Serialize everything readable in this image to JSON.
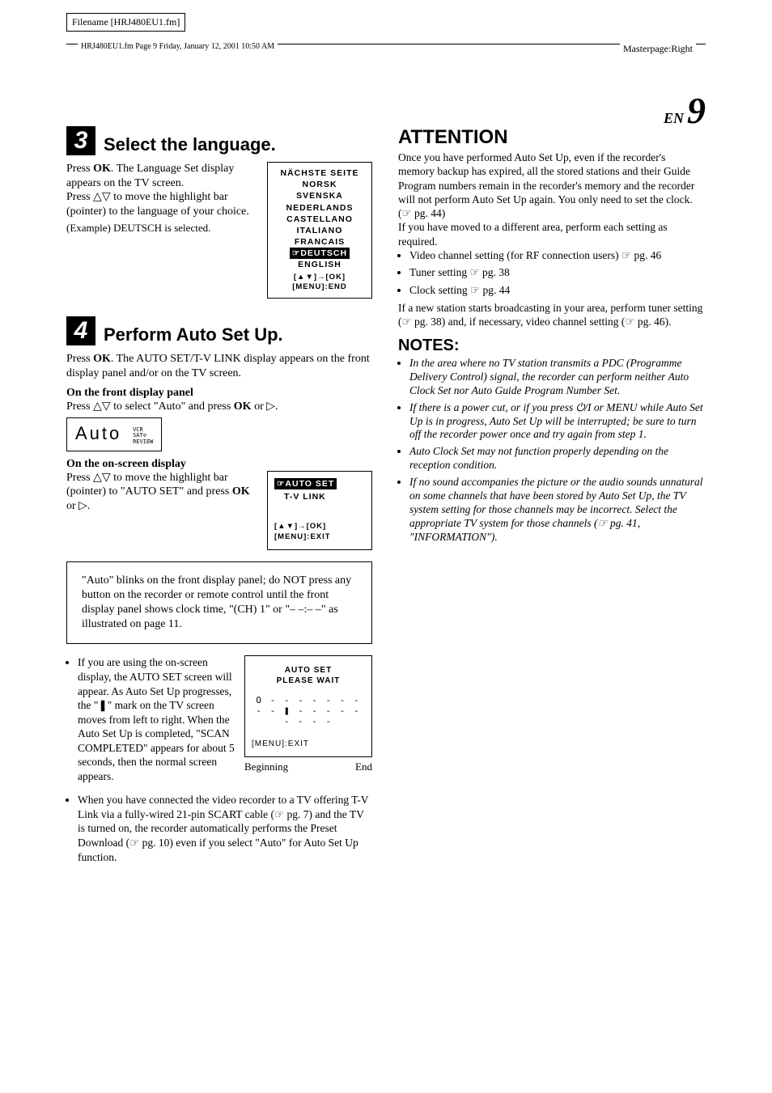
{
  "meta": {
    "filename_label": "Filename [HRJ480EU1.fm]",
    "header_text": "HRJ480EU1.fm  Page 9  Friday, January 12, 2001  10:50 AM",
    "masterpage": "Masterpage:Right",
    "page_lang": "EN",
    "page_num": "9"
  },
  "step3": {
    "num": "3",
    "title": "Select the language.",
    "p1a": "Press ",
    "p1ok": "OK",
    "p1b": ". The Language Set display appears on the TV screen.",
    "p2a": "Press △▽ to move the highlight bar (pointer) to the language of your choice.",
    "p3": "(Example) DEUTSCH is selected.",
    "panel": {
      "l1": "NÄCHSTE SEITE",
      "l2": "NORSK",
      "l3": "SVENSKA",
      "l4": "NEDERLANDS",
      "l5": "CASTELLANO",
      "l6": "ITALIANO",
      "l7": "FRANCAIS",
      "sel": "☞DEUTSCH",
      "l8": "ENGLISH",
      "bot": "[▲▼]→[OK]\n[MENU]:END"
    }
  },
  "step4": {
    "num": "4",
    "title": "Perform Auto Set Up.",
    "p1a": "Press ",
    "p1ok": "OK",
    "p1b": ". The AUTO SET/T-V LINK display appears on the front display panel and/or on the TV screen.",
    "sub1": "On the front display panel",
    "sel_auto": "Press △▽ to select \"Auto\" and press ",
    "ok": "OK",
    "or_tri": " or ▷.",
    "seg_text": "Auto",
    "seg_side": "VCR\nSAT⊙\nREVIEW",
    "sub2": "On the on-screen display",
    "p3": "Press △▽ to move the highlight bar (pointer) to \"AUTO SET\" and press ",
    "p3b": " or ▷.",
    "panel2": {
      "sel": "☞AUTO SET",
      "l2": "T-V LINK",
      "bot": "[▲▼]→[OK]\n[MENU]:EXIT"
    },
    "blockquote": "\"Auto\" blinks on the front display panel; do NOT press any button on the recorder or remote control until the front display panel shows clock time, \"(CH) 1\" or \"– –:– –\" as illustrated on page 11.",
    "bul1": "If you are using the on-screen display, the AUTO SET screen will appear. As Auto Set Up progresses, the \"❚\" mark on the TV screen moves from left to right. When the Auto Set Up is completed, \"SCAN COMPLETED\" appears for about 5 seconds, then the normal screen appears.",
    "progress": {
      "t1": "AUTO SET",
      "t2": "PLEASE WAIT",
      "row": "O - - - - -    - - - - ❚ - - - -    - - - - -",
      "menu": "[MENU]:EXIT",
      "beg": "Beginning",
      "end": "End"
    },
    "bul2": "When you have connected the video recorder to a TV offering T-V Link via a fully-wired 21-pin SCART cable (☞ pg. 7) and the TV is turned on, the recorder automatically performs the Preset Download (☞ pg. 10) even if you select \"Auto\" for Auto Set Up function."
  },
  "right": {
    "att_title": "ATTENTION",
    "att_p1": "Once you have performed Auto Set Up, even if the recorder's memory backup has expired, all the stored stations and their Guide Program numbers remain in the recorder's memory and the recorder will not perform Auto Set Up again. You only need to set the clock. (☞ pg. 44)",
    "att_p2": "If you have moved to a different area, perform each setting as required.",
    "att_li1": "Video channel setting (for RF connection users) ☞ pg. 46",
    "att_li2": "Tuner setting ☞ pg. 38",
    "att_li3": "Clock setting ☞ pg. 44",
    "att_p3": "If a new station starts broadcasting in your area, perform tuner setting (☞ pg. 38) and, if necessary, video channel setting (☞ pg. 46).",
    "notes_title": "NOTES:",
    "n1": "In the area where no TV station transmits a PDC (Programme Delivery Control) signal, the recorder can perform neither Auto Clock Set nor Auto Guide Program Number Set.",
    "n2": "If there is a power cut, or if you press ⏻/I or MENU while Auto Set Up is in progress, Auto Set Up will be interrupted; be sure to turn off the recorder power once and try again from step 1.",
    "n3": "Auto Clock Set may not function properly depending on the reception condition.",
    "n4": "If no sound accompanies the picture or the audio sounds unnatural on some channels that have been stored by Auto Set Up, the TV system setting for those channels may be incorrect. Select the appropriate TV system for those channels (☞ pg. 41, \"INFORMATION\")."
  }
}
